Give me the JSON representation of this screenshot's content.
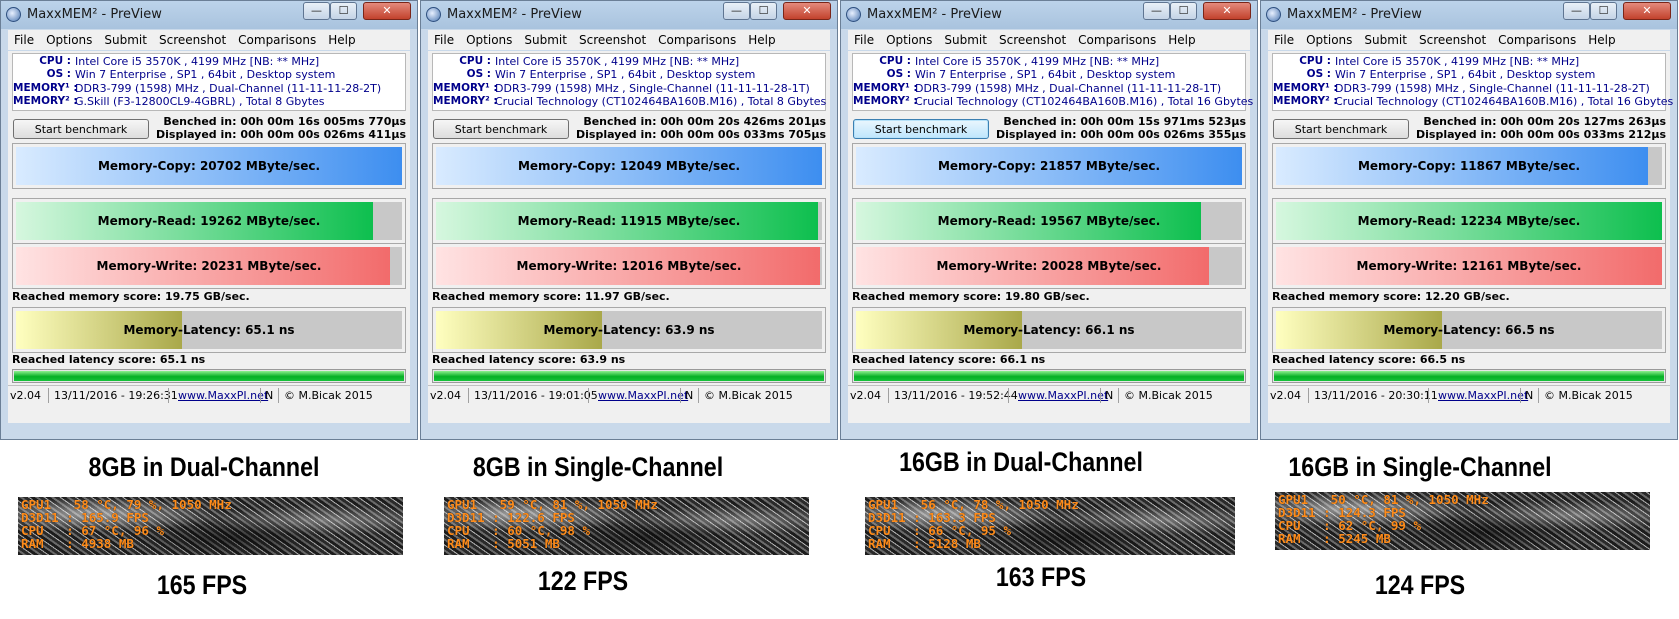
{
  "windows": [
    {
      "title": "MaxxMEM² - PreView",
      "min_glyph": "—",
      "max_glyph": "☐",
      "close_glyph": "✕",
      "menu": [
        "File",
        "Options",
        "Submit",
        "Screenshot",
        "Comparisons",
        "Help"
      ],
      "info": {
        "cpu_key": "CPU :",
        "cpu": "Intel Core i5 3570K , 4199 MHz  [NB: ** MHz]",
        "os_key": "OS :",
        "os": "Win 7 Enterprise , SP1 , 64bit , Desktop system",
        "mem1_key": "MEMORY¹ :",
        "mem1": "DDR3-799 (1598) MHz , Dual-Channel (11-11-11-28-2T)",
        "mem2_key": "MEMORY² :",
        "mem2": "G.Skill (F3-12800CL9-4GBRL) , Total 8 Gbytes"
      },
      "button": "Start benchmark",
      "benched": "Benched in: 00h 00m 16s 005ms 770µs",
      "displayed": "Displayed in: 00h 00m 00s 026ms 411µs",
      "copy": {
        "label": "Memory-Copy: 20702 MByte/sec.",
        "fill": 1.0
      },
      "read": {
        "label": "Memory-Read: 19262 MByte/sec.",
        "fill": 0.925
      },
      "write": {
        "label": "Memory-Write: 20231 MByte/sec.",
        "fill": 0.97
      },
      "mem_score": "Reached memory score: 19.75 GB/sec.",
      "latency": {
        "label": "Memory-Latency: 65.1 ns",
        "fill": 0.43
      },
      "lat_score": "Reached latency score: 65.1 ns",
      "progress": 1.0,
      "status": {
        "version": "v2.04",
        "date": "13/11/2016 - 19:26:31",
        "link": "www.MaxxPI.net",
        "n": "N",
        "copyright": "© M.Bicak 2015"
      }
    },
    {
      "title": "MaxxMEM² - PreView",
      "min_glyph": "—",
      "max_glyph": "☐",
      "close_glyph": "✕",
      "menu": [
        "File",
        "Options",
        "Submit",
        "Screenshot",
        "Comparisons",
        "Help"
      ],
      "info": {
        "cpu_key": "CPU :",
        "cpu": "Intel Core i5 3570K , 4199 MHz  [NB: ** MHz]",
        "os_key": "OS :",
        "os": "Win 7 Enterprise , SP1 , 64bit , Desktop system",
        "mem1_key": "MEMORY¹ :",
        "mem1": "DDR3-799 (1598) MHz , Single-Channel (11-11-11-28-1T)",
        "mem2_key": "MEMORY² :",
        "mem2": "Crucial Technology (CT102464BA160B.M16) , Total 8 Gbytes"
      },
      "button": "Start benchmark",
      "benched": "Benched in: 00h 00m 20s 426ms 201µs",
      "displayed": "Displayed in: 00h 00m 00s 033ms 705µs",
      "copy": {
        "label": "Memory-Copy: 12049 MByte/sec.",
        "fill": 1.0
      },
      "read": {
        "label": "Memory-Read: 11915 MByte/sec.",
        "fill": 0.99
      },
      "write": {
        "label": "Memory-Write: 12016 MByte/sec.",
        "fill": 0.995
      },
      "mem_score": "Reached memory score: 11.97 GB/sec.",
      "latency": {
        "label": "Memory-Latency: 63.9 ns",
        "fill": 0.43
      },
      "lat_score": "Reached latency score: 63.9 ns",
      "progress": 1.0,
      "status": {
        "version": "v2.04",
        "date": "13/11/2016 - 19:01:05",
        "link": "www.MaxxPI.net",
        "n": "N",
        "copyright": "© M.Bicak 2015"
      }
    },
    {
      "title": "MaxxMEM² - PreView",
      "min_glyph": "—",
      "max_glyph": "☐",
      "close_glyph": "✕",
      "menu": [
        "File",
        "Options",
        "Submit",
        "Screenshot",
        "Comparisons",
        "Help"
      ],
      "info": {
        "cpu_key": "CPU :",
        "cpu": "Intel Core i5 3570K , 4199 MHz  [NB: ** MHz]",
        "os_key": "OS :",
        "os": "Win 7 Enterprise , SP1 , 64bit , Desktop system",
        "mem1_key": "MEMORY¹ :",
        "mem1": "DDR3-799 (1598) MHz , Dual-Channel (11-11-11-28-1T)",
        "mem2_key": "MEMORY² :",
        "mem2": "Crucial Technology (CT102464BA160B.M16) , Total 16 Gbytes"
      },
      "button": "Start benchmark",
      "button_focused": true,
      "benched": "Benched in: 00h 00m 15s 971ms 523µs",
      "displayed": "Displayed in: 00h 00m 00s 026ms 355µs",
      "copy": {
        "label": "Memory-Copy: 21857 MByte/sec.",
        "fill": 1.0
      },
      "read": {
        "label": "Memory-Read: 19567 MByte/sec.",
        "fill": 0.895
      },
      "write": {
        "label": "Memory-Write: 20028 MByte/sec.",
        "fill": 0.915
      },
      "mem_score": "Reached memory score: 19.80 GB/sec.",
      "latency": {
        "label": "Memory-Latency: 66.1 ns",
        "fill": 0.43
      },
      "lat_score": "Reached latency score: 66.1 ns",
      "progress": 1.0,
      "status": {
        "version": "v2.04",
        "date": "13/11/2016 - 19:52:44",
        "link": "www.MaxxPI.net",
        "n": "N",
        "copyright": "© M.Bicak 2015"
      }
    },
    {
      "title": "MaxxMEM² - PreView",
      "min_glyph": "—",
      "max_glyph": "☐",
      "close_glyph": "✕",
      "menu": [
        "File",
        "Options",
        "Submit",
        "Screenshot",
        "Comparisons",
        "Help"
      ],
      "info": {
        "cpu_key": "CPU :",
        "cpu": "Intel Core i5 3570K , 4199 MHz  [NB: ** MHz]",
        "os_key": "OS :",
        "os": "Win 7 Enterprise , SP1 , 64bit , Desktop system",
        "mem1_key": "MEMORY¹ :",
        "mem1": "DDR3-799 (1598) MHz , Single-Channel (11-11-11-28-2T)",
        "mem2_key": "MEMORY² :",
        "mem2": "Crucial Technology (CT102464BA160B.M16) , Total 16 Gbytes"
      },
      "button": "Start benchmark",
      "benched": "Benched in: 00h 00m 20s 127ms 263µs",
      "displayed": "Displayed in: 00h 00m 00s 033ms 212µs",
      "copy": {
        "label": "Memory-Copy: 11867 MByte/sec.",
        "fill": 0.965
      },
      "read": {
        "label": "Memory-Read: 12234 MByte/sec.",
        "fill": 1.0
      },
      "write": {
        "label": "Memory-Write: 12161 MByte/sec.",
        "fill": 1.0
      },
      "mem_score": "Reached memory score: 12.20 GB/sec.",
      "latency": {
        "label": "Memory-Latency: 66.5 ns",
        "fill": 0.43
      },
      "lat_score": "Reached latency score: 66.5 ns",
      "progress": 1.0,
      "status": {
        "version": "v2.04",
        "date": "13/11/2016 - 20:30:11",
        "link": "www.MaxxPI.net",
        "n": "N",
        "copyright": "© M.Bicak 2015"
      }
    }
  ],
  "captions": [
    "8GB in Dual-Channel",
    "8GB in Single-Channel",
    "16GB in Dual-Channel",
    "16GB in Single-Channel"
  ],
  "osd": [
    {
      "lines": [
        "GPU1   58 °C, 79 %, 1050 MHz",
        "D3D11 : 165.9 FPS",
        "CPU   : 67 °C, 96 %",
        "RAM   : 4938 MB"
      ]
    },
    {
      "lines": [
        "GPU1   59 °C, 81 %, 1050 MHz",
        "D3D11 : 122.6 FPS",
        "CPU   : 60 °C, 98 %",
        "RAM   : 5051 MB"
      ]
    },
    {
      "lines": [
        "GPU1   56 °C, 78 %, 1050 MHz",
        "D3D11 : 163.3 FPS",
        "CPU   : 66 °C, 95 %",
        "RAM   : 5128 MB"
      ]
    },
    {
      "lines": [
        "GPU1   50 °C, 81 %, 1050 MHz",
        "D3D11 : 124.3 FPS",
        "CPU   : 62 °C, 99 %",
        "RAM   : 5245 MB"
      ]
    }
  ],
  "fps": [
    "165 FPS",
    "122 FPS",
    "163 FPS",
    "124 FPS"
  ],
  "colors": {
    "copy_fill": "#3d8ef0",
    "read_fill": "#0dbf4e",
    "write_fill": "#f26b6b",
    "latency_fill": "#a9a84a",
    "info_text": "#00008b",
    "osd_text": "#ff8c1a"
  }
}
